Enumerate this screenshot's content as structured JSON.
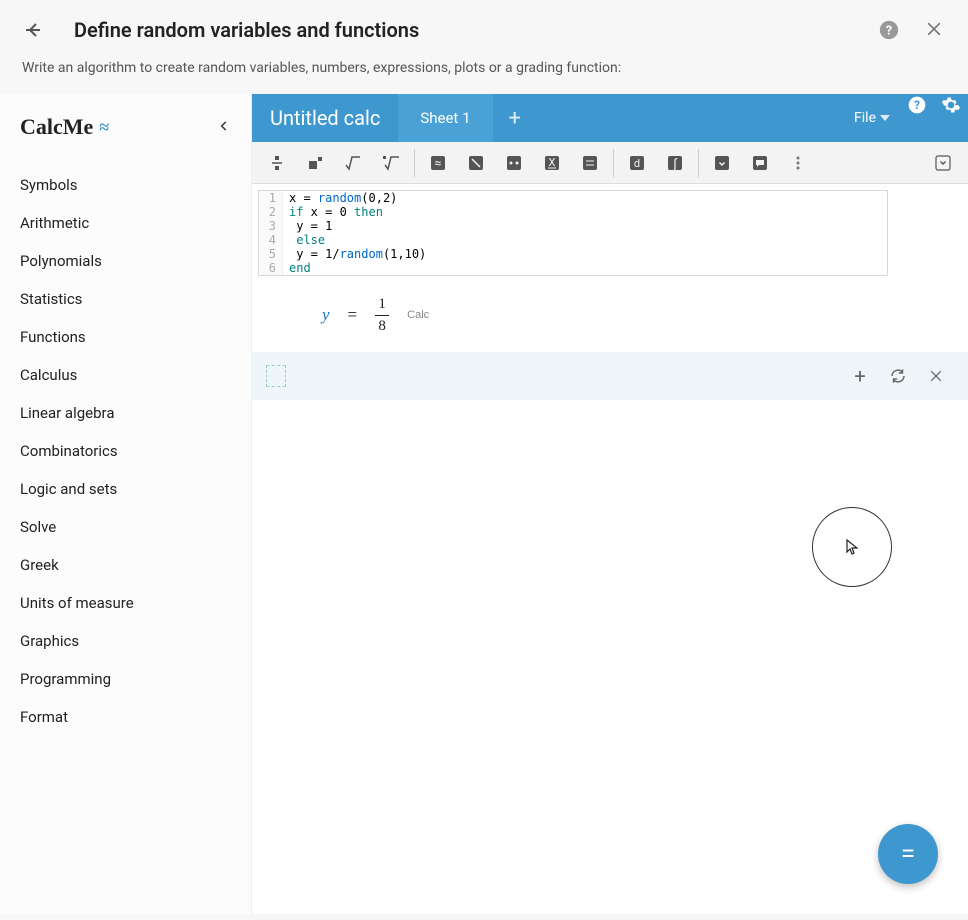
{
  "header": {
    "title": "Define random variables and functions",
    "subtitle": "Write an algorithm to create random variables, numbers, expressions, plots or a grading function:"
  },
  "brand": {
    "name": "CalcMe"
  },
  "sidebar": {
    "items": [
      {
        "label": "Symbols"
      },
      {
        "label": "Arithmetic"
      },
      {
        "label": "Polynomials"
      },
      {
        "label": "Statistics"
      },
      {
        "label": "Functions"
      },
      {
        "label": "Calculus"
      },
      {
        "label": "Linear algebra"
      },
      {
        "label": "Combinatorics"
      },
      {
        "label": "Logic and sets"
      },
      {
        "label": "Solve"
      },
      {
        "label": "Greek"
      },
      {
        "label": "Units of measure"
      },
      {
        "label": "Graphics"
      },
      {
        "label": "Programming"
      },
      {
        "label": "Format"
      }
    ]
  },
  "tabs": {
    "doc_title": "Untitled calc",
    "sheet_label": "Sheet 1",
    "file_label": "File"
  },
  "code": {
    "lines": [
      {
        "num": "1",
        "tokens": [
          {
            "t": "x = ",
            "c": ""
          },
          {
            "t": "random",
            "c": "kw-blue"
          },
          {
            "t": "(0,2)",
            "c": ""
          }
        ]
      },
      {
        "num": "2",
        "tokens": [
          {
            "t": "if",
            "c": "kw-teal"
          },
          {
            "t": " x = 0 ",
            "c": ""
          },
          {
            "t": "then",
            "c": "kw-teal"
          }
        ]
      },
      {
        "num": "3",
        "tokens": [
          {
            "t": " y = 1",
            "c": ""
          }
        ]
      },
      {
        "num": "4",
        "tokens": [
          {
            "t": " ",
            "c": ""
          },
          {
            "t": "else",
            "c": "kw-teal"
          }
        ]
      },
      {
        "num": "5",
        "tokens": [
          {
            "t": " y = 1/",
            "c": ""
          },
          {
            "t": "random",
            "c": "kw-blue"
          },
          {
            "t": "(1,10)",
            "c": ""
          }
        ]
      },
      {
        "num": "6",
        "tokens": [
          {
            "t": "end",
            "c": "kw-teal"
          }
        ]
      }
    ]
  },
  "result": {
    "var": "y",
    "eq": "=",
    "numerator": "1",
    "denominator": "8",
    "label": "Calc"
  },
  "fab": {
    "glyph": "="
  }
}
